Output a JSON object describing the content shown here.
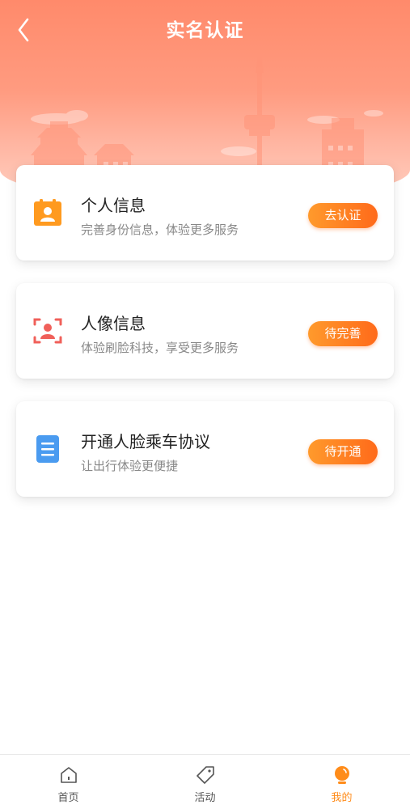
{
  "header": {
    "title": "实名认证"
  },
  "cards": [
    {
      "title": "个人信息",
      "subtitle": "完善身份信息，体验更多服务",
      "button": "去认证",
      "icon": "id-card-icon"
    },
    {
      "title": "人像信息",
      "subtitle": "体验刷脸科技，享受更多服务",
      "button": "待完善",
      "icon": "face-scan-icon"
    },
    {
      "title": "开通人脸乘车协议",
      "subtitle": "让出行体验更便捷",
      "button": "待开通",
      "icon": "document-icon"
    }
  ],
  "tabbar": {
    "items": [
      {
        "label": "首页",
        "icon": "home-icon",
        "active": false
      },
      {
        "label": "活动",
        "icon": "tag-icon",
        "active": false
      },
      {
        "label": "我的",
        "icon": "profile-icon",
        "active": true
      }
    ]
  },
  "colors": {
    "header_gradient_top": "#ff8a6b",
    "button_orange": "#ff7a1f",
    "active_tab": "#ff8c1a",
    "face_icon_red": "#f0605a",
    "doc_icon_blue": "#4a9bf0"
  }
}
